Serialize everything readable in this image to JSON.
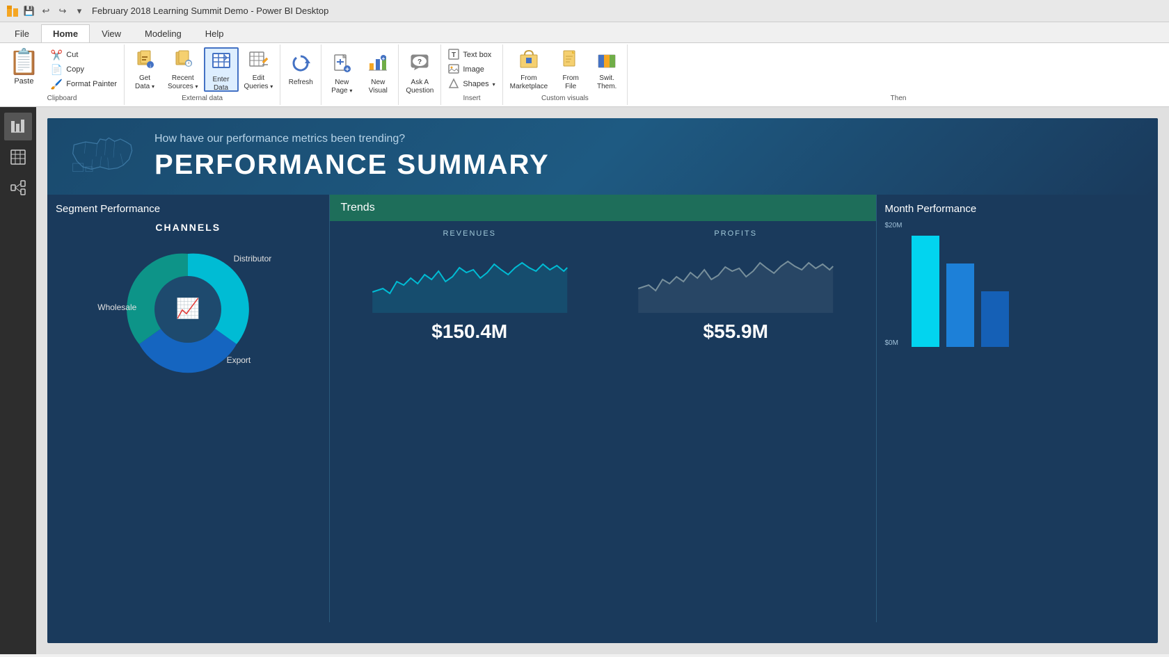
{
  "titleBar": {
    "title": "February 2018 Learning Summit Demo - Power BI Desktop",
    "icons": [
      "save",
      "undo",
      "redo",
      "dropdown"
    ]
  },
  "menuTabs": [
    {
      "id": "file",
      "label": "File",
      "active": false
    },
    {
      "id": "home",
      "label": "Home",
      "active": true
    },
    {
      "id": "view",
      "label": "View",
      "active": false
    },
    {
      "id": "modeling",
      "label": "Modeling",
      "active": false
    },
    {
      "id": "help",
      "label": "Help",
      "active": false
    }
  ],
  "ribbon": {
    "groups": [
      {
        "id": "clipboard",
        "label": "Clipboard",
        "buttons": [
          {
            "id": "paste",
            "label": "Paste",
            "icon": "📋",
            "large": true
          },
          {
            "id": "cut",
            "label": "Cut",
            "icon": "✂️",
            "small": true
          },
          {
            "id": "copy",
            "label": "Copy",
            "icon": "📄",
            "small": true
          },
          {
            "id": "format-painter",
            "label": "Format Painter",
            "icon": "🖌️",
            "small": true
          }
        ]
      },
      {
        "id": "external-data",
        "label": "External data",
        "buttons": [
          {
            "id": "get-data",
            "label": "Get\nData",
            "icon": "🗄️",
            "hasArrow": true
          },
          {
            "id": "recent-sources",
            "label": "Recent\nSources",
            "icon": "🕐",
            "hasArrow": true
          },
          {
            "id": "enter-data",
            "label": "Enter\nData",
            "icon": "📊",
            "active": true
          },
          {
            "id": "edit-queries",
            "label": "Edit\nQueries",
            "icon": "📝",
            "hasArrow": true
          }
        ]
      },
      {
        "id": "queries",
        "label": "",
        "buttons": [
          {
            "id": "refresh",
            "label": "Refresh",
            "icon": "🔄"
          }
        ]
      },
      {
        "id": "insert-pages",
        "label": "",
        "buttons": [
          {
            "id": "new-page",
            "label": "New\nPage",
            "icon": "📄",
            "hasArrow": true
          },
          {
            "id": "new-visual",
            "label": "New\nVisual",
            "icon": "📊"
          }
        ]
      },
      {
        "id": "ask-question",
        "label": "",
        "buttons": [
          {
            "id": "ask-question",
            "label": "Ask A\nQuestion",
            "icon": "💬"
          }
        ]
      },
      {
        "id": "insert",
        "label": "Insert",
        "buttons": [
          {
            "id": "text-box",
            "label": "Text box",
            "icon": "📝",
            "small": true
          },
          {
            "id": "image",
            "label": "Image",
            "icon": "🖼️",
            "small": true
          },
          {
            "id": "shapes",
            "label": "Shapes",
            "icon": "⬡",
            "small": true,
            "hasArrow": true
          }
        ]
      },
      {
        "id": "custom-visuals",
        "label": "Custom visuals",
        "buttons": [
          {
            "id": "from-marketplace",
            "label": "From\nMarketplace",
            "icon": "🛒"
          },
          {
            "id": "from-file",
            "label": "From\nFile",
            "icon": "📁"
          },
          {
            "id": "switch-theme",
            "label": "Swit.\nThem.",
            "icon": "🎨"
          }
        ]
      },
      {
        "id": "themes",
        "label": "Then",
        "buttons": []
      }
    ]
  },
  "sidebar": {
    "items": [
      {
        "id": "report",
        "icon": "📊",
        "active": true
      },
      {
        "id": "data",
        "icon": "⊞",
        "active": false
      },
      {
        "id": "model",
        "icon": "⬡",
        "active": false
      }
    ]
  },
  "dashboard": {
    "subtitle": "How have our performance metrics been trending?",
    "title": "PERFORMANCE SUMMARY",
    "panels": {
      "segment": {
        "title": "Segment Performance",
        "chartTitle": "CHANNELS",
        "segments": [
          {
            "label": "Distributor",
            "value": 45,
            "color": "#00bcd4"
          },
          {
            "label": "Wholesale",
            "value": 35,
            "color": "#1565c0"
          },
          {
            "label": "Export",
            "value": 20,
            "color": "#4caf50"
          }
        ]
      },
      "trends": {
        "title": "Trends",
        "charts": [
          {
            "title": "REVENUES",
            "value": "$150.4M",
            "color": "#00bcd4"
          },
          {
            "title": "PROFITS",
            "value": "$55.9M",
            "color": "#78909c"
          }
        ]
      },
      "month": {
        "title": "Month Performance",
        "values": [
          "$20M",
          "$0M"
        ],
        "colors": [
          "#00e5ff",
          "#1e88e5",
          "#1565c0"
        ]
      }
    }
  }
}
